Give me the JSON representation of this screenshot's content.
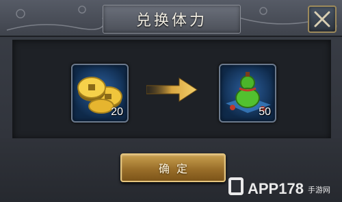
{
  "dialog": {
    "title": "兑换体力",
    "close_icon": "close-x-icon"
  },
  "exchange": {
    "cost_item": {
      "icon": "gold-coins-icon",
      "count": "20"
    },
    "arrow_icon": "right-arrow-icon",
    "reward_item": {
      "icon": "stamina-gourd-icon",
      "count": "50"
    }
  },
  "footer": {
    "confirm_label": "确定"
  },
  "watermark": {
    "text": "APP178手游网"
  },
  "colors": {
    "gold_button": "#b8893c",
    "slot_blue": "#1e4a7e",
    "arrow_gold": "#d9a640"
  }
}
